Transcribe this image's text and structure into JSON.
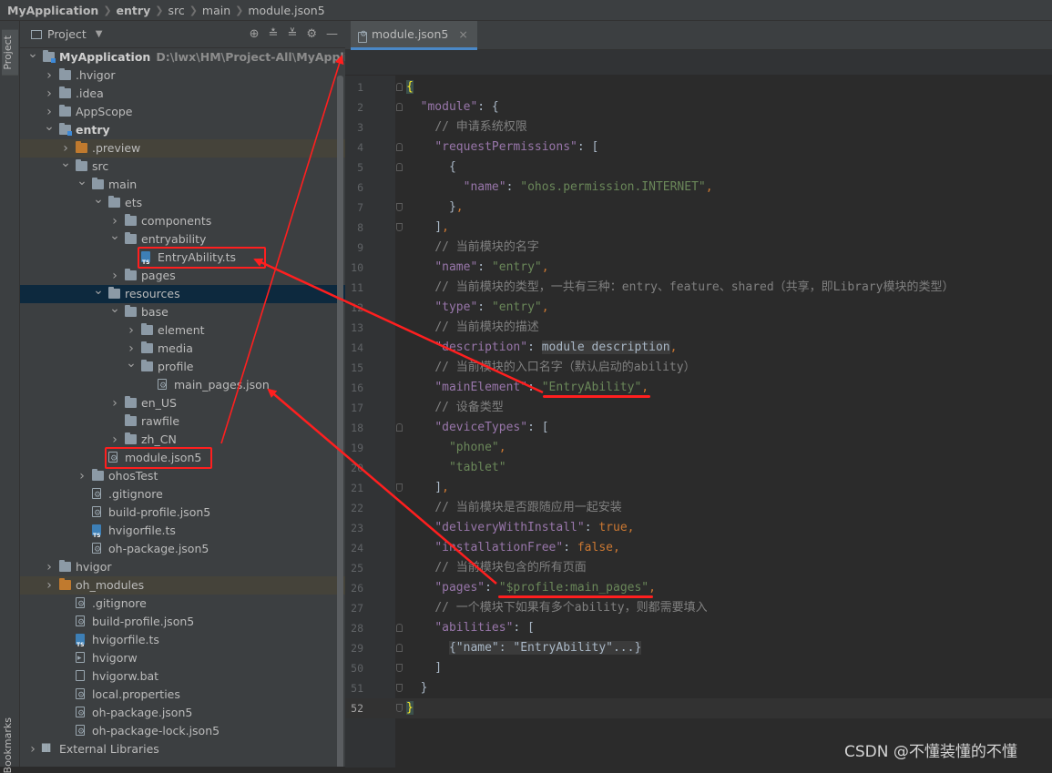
{
  "breadcrumb": [
    {
      "label": "MyApplication",
      "bold": true
    },
    {
      "label": "entry",
      "bold": true
    },
    {
      "label": "src",
      "bold": false
    },
    {
      "label": "main",
      "bold": false
    },
    {
      "label": "module.json5",
      "bold": false
    }
  ],
  "tool_windows": {
    "project": "Project",
    "bookmarks": "Bookmarks"
  },
  "panel": {
    "title": "Project",
    "tools": [
      "⊕",
      "≛",
      "≚",
      "⚙",
      "—"
    ]
  },
  "tree": [
    {
      "label": "MyApplication",
      "hint": "D:\\lwx\\HM\\Project-All\\MyApplicatic",
      "depth": 0,
      "arrow": "open",
      "icon": "folder-module",
      "bold": true
    },
    {
      "label": ".hvigor",
      "depth": 1,
      "arrow": "closed",
      "icon": "folder"
    },
    {
      "label": ".idea",
      "depth": 1,
      "arrow": "closed",
      "icon": "folder"
    },
    {
      "label": "AppScope",
      "depth": 1,
      "arrow": "closed",
      "icon": "folder"
    },
    {
      "label": "entry",
      "depth": 1,
      "arrow": "open",
      "icon": "folder-module",
      "bold": true
    },
    {
      "label": ".preview",
      "depth": 2,
      "arrow": "closed",
      "icon": "folder-orange",
      "state": "preview"
    },
    {
      "label": "src",
      "depth": 2,
      "arrow": "open",
      "icon": "folder"
    },
    {
      "label": "main",
      "depth": 3,
      "arrow": "open",
      "icon": "folder"
    },
    {
      "label": "ets",
      "depth": 4,
      "arrow": "open",
      "icon": "folder"
    },
    {
      "label": "components",
      "depth": 5,
      "arrow": "closed",
      "icon": "folder"
    },
    {
      "label": "entryability",
      "depth": 5,
      "arrow": "open",
      "icon": "folder"
    },
    {
      "label": "EntryAbility.ts",
      "depth": 6,
      "arrow": "none",
      "icon": "file-ts",
      "boxed": true
    },
    {
      "label": "pages",
      "depth": 5,
      "arrow": "closed",
      "icon": "folder"
    },
    {
      "label": "resources",
      "depth": 4,
      "arrow": "open",
      "icon": "folder",
      "state": "selected"
    },
    {
      "label": "base",
      "depth": 5,
      "arrow": "open",
      "icon": "folder"
    },
    {
      "label": "element",
      "depth": 6,
      "arrow": "closed",
      "icon": "folder"
    },
    {
      "label": "media",
      "depth": 6,
      "arrow": "closed",
      "icon": "folder"
    },
    {
      "label": "profile",
      "depth": 6,
      "arrow": "open",
      "icon": "folder"
    },
    {
      "label": "main_pages.json",
      "depth": 7,
      "arrow": "none",
      "icon": "file-gear"
    },
    {
      "label": "en_US",
      "depth": 5,
      "arrow": "closed",
      "icon": "folder"
    },
    {
      "label": "rawfile",
      "depth": 5,
      "arrow": "none",
      "icon": "folder"
    },
    {
      "label": "zh_CN",
      "depth": 5,
      "arrow": "closed",
      "icon": "folder"
    },
    {
      "label": "module.json5",
      "depth": 4,
      "arrow": "none",
      "icon": "file-gear",
      "boxed": true
    },
    {
      "label": "ohosTest",
      "depth": 3,
      "arrow": "closed",
      "icon": "folder"
    },
    {
      "label": ".gitignore",
      "depth": 3,
      "arrow": "none",
      "icon": "file-gear"
    },
    {
      "label": "build-profile.json5",
      "depth": 3,
      "arrow": "none",
      "icon": "file-gear"
    },
    {
      "label": "hvigorfile.ts",
      "depth": 3,
      "arrow": "none",
      "icon": "file-ts"
    },
    {
      "label": "oh-package.json5",
      "depth": 3,
      "arrow": "none",
      "icon": "file-gear"
    },
    {
      "label": "hvigor",
      "depth": 1,
      "arrow": "closed",
      "icon": "folder"
    },
    {
      "label": "oh_modules",
      "depth": 1,
      "arrow": "closed",
      "icon": "folder-orange",
      "state": "modules"
    },
    {
      "label": ".gitignore",
      "depth": 2,
      "arrow": "none",
      "icon": "file-gear"
    },
    {
      "label": "build-profile.json5",
      "depth": 2,
      "arrow": "none",
      "icon": "file-gear"
    },
    {
      "label": "hvigorfile.ts",
      "depth": 2,
      "arrow": "none",
      "icon": "file-ts"
    },
    {
      "label": "hvigorw",
      "depth": 2,
      "arrow": "none",
      "icon": "file-exe"
    },
    {
      "label": "hvigorw.bat",
      "depth": 2,
      "arrow": "none",
      "icon": "file"
    },
    {
      "label": "local.properties",
      "depth": 2,
      "arrow": "none",
      "icon": "file-gear"
    },
    {
      "label": "oh-package.json5",
      "depth": 2,
      "arrow": "none",
      "icon": "file-gear"
    },
    {
      "label": "oh-package-lock.json5",
      "depth": 2,
      "arrow": "none",
      "icon": "file-gear"
    },
    {
      "label": "External Libraries",
      "depth": 0,
      "arrow": "closed",
      "icon": "file-lib"
    }
  ],
  "editor": {
    "tab_label": "module.json5",
    "tab_close": "×",
    "lines": [
      {
        "n": "1",
        "fold": "up",
        "parts": [
          [
            "brace-hl",
            "{"
          ]
        ]
      },
      {
        "n": "2",
        "fold": "up",
        "parts": [
          [
            "p",
            "  "
          ],
          [
            "k",
            "\"module\""
          ],
          [
            "p",
            ": {"
          ]
        ]
      },
      {
        "n": "3",
        "parts": [
          [
            "p",
            "    "
          ],
          [
            "c",
            "// 申请系统权限"
          ]
        ]
      },
      {
        "n": "4",
        "fold": "up",
        "parts": [
          [
            "p",
            "    "
          ],
          [
            "k",
            "\"requestPermissions\""
          ],
          [
            "p",
            ": ["
          ]
        ]
      },
      {
        "n": "5",
        "fold": "up",
        "parts": [
          [
            "p",
            "      {"
          ]
        ]
      },
      {
        "n": "6",
        "parts": [
          [
            "p",
            "        "
          ],
          [
            "k",
            "\"name\""
          ],
          [
            "p",
            ": "
          ],
          [
            "s",
            "\"ohos.permission.INTERNET\""
          ],
          [
            "b",
            ","
          ]
        ]
      },
      {
        "n": "7",
        "fold": "down",
        "parts": [
          [
            "p",
            "      }"
          ],
          [
            "b",
            ","
          ]
        ]
      },
      {
        "n": "8",
        "fold": "down",
        "parts": [
          [
            "p",
            "    ]"
          ],
          [
            "b",
            ","
          ]
        ]
      },
      {
        "n": "9",
        "parts": [
          [
            "p",
            "    "
          ],
          [
            "c",
            "// 当前模块的名字"
          ]
        ]
      },
      {
        "n": "10",
        "parts": [
          [
            "p",
            "    "
          ],
          [
            "k",
            "\"name\""
          ],
          [
            "p",
            ": "
          ],
          [
            "s",
            "\"entry\""
          ],
          [
            "b",
            ","
          ]
        ]
      },
      {
        "n": "11",
        "parts": [
          [
            "p",
            "    "
          ],
          [
            "c",
            "// 当前模块的类型，一共有三种：entry、feature、shared（共享，即Library模块的类型）"
          ]
        ]
      },
      {
        "n": "12",
        "parts": [
          [
            "p",
            "    "
          ],
          [
            "k",
            "\"type\""
          ],
          [
            "p",
            ": "
          ],
          [
            "s",
            "\"entry\""
          ],
          [
            "b",
            ","
          ]
        ]
      },
      {
        "n": "13",
        "parts": [
          [
            "p",
            "    "
          ],
          [
            "c",
            "// 当前模块的描述"
          ]
        ]
      },
      {
        "n": "14",
        "parts": [
          [
            "p",
            "    "
          ],
          [
            "k",
            "\"description\""
          ],
          [
            "p",
            ": "
          ],
          [
            "g",
            "module description"
          ],
          [
            "b",
            ","
          ]
        ]
      },
      {
        "n": "15",
        "parts": [
          [
            "p",
            "    "
          ],
          [
            "c",
            "// 当前模块的入口名字（默认启动的ability）"
          ]
        ]
      },
      {
        "n": "16",
        "parts": [
          [
            "p",
            "    "
          ],
          [
            "k",
            "\"mainElement\""
          ],
          [
            "p",
            ": "
          ],
          [
            "s",
            "\"EntryAbility\""
          ],
          [
            "b",
            ","
          ]
        ]
      },
      {
        "n": "17",
        "parts": [
          [
            "p",
            "    "
          ],
          [
            "c",
            "// 设备类型"
          ]
        ]
      },
      {
        "n": "18",
        "fold": "up",
        "parts": [
          [
            "p",
            "    "
          ],
          [
            "k",
            "\"deviceTypes\""
          ],
          [
            "p",
            ": ["
          ]
        ]
      },
      {
        "n": "19",
        "parts": [
          [
            "p",
            "      "
          ],
          [
            "s",
            "\"phone\""
          ],
          [
            "b",
            ","
          ]
        ]
      },
      {
        "n": "20",
        "parts": [
          [
            "p",
            "      "
          ],
          [
            "s",
            "\"tablet\""
          ]
        ]
      },
      {
        "n": "21",
        "fold": "down",
        "parts": [
          [
            "p",
            "    ]"
          ],
          [
            "b",
            ","
          ]
        ]
      },
      {
        "n": "22",
        "parts": [
          [
            "p",
            "    "
          ],
          [
            "c",
            "// 当前模块是否跟随应用一起安装"
          ]
        ]
      },
      {
        "n": "23",
        "parts": [
          [
            "p",
            "    "
          ],
          [
            "k",
            "\"deliveryWithInstall\""
          ],
          [
            "p",
            ": "
          ],
          [
            "b",
            "true,"
          ]
        ]
      },
      {
        "n": "24",
        "parts": [
          [
            "p",
            "    "
          ],
          [
            "k",
            "\"installationFree\""
          ],
          [
            "p",
            ": "
          ],
          [
            "b",
            "false,"
          ]
        ]
      },
      {
        "n": "25",
        "parts": [
          [
            "p",
            "    "
          ],
          [
            "c",
            "// 当前模块包含的所有页面"
          ]
        ]
      },
      {
        "n": "26",
        "parts": [
          [
            "p",
            "    "
          ],
          [
            "k",
            "\"pages\""
          ],
          [
            "p",
            ": "
          ],
          [
            "s",
            "\"$profile:main_pages\""
          ],
          [
            "b",
            ","
          ]
        ]
      },
      {
        "n": "27",
        "parts": [
          [
            "p",
            "    "
          ],
          [
            "c",
            "// 一个模块下如果有多个ability，则都需要填入"
          ]
        ]
      },
      {
        "n": "28",
        "fold": "up",
        "parts": [
          [
            "p",
            "    "
          ],
          [
            "k",
            "\"abilities\""
          ],
          [
            "p",
            ": ["
          ]
        ]
      },
      {
        "n": "29",
        "fold": "up",
        "parts": [
          [
            "p",
            "      "
          ],
          [
            "g",
            "{\"name\": \"EntryAbility\"...}"
          ]
        ]
      },
      {
        "n": "50",
        "fold": "down",
        "parts": [
          [
            "p",
            "    ]"
          ]
        ]
      },
      {
        "n": "51",
        "fold": "down",
        "parts": [
          [
            "p",
            "  }"
          ]
        ]
      },
      {
        "n": "52",
        "fold": "down",
        "current": true,
        "parts": [
          [
            "brace-hl",
            "}"
          ]
        ]
      }
    ]
  },
  "watermark": "CSDN @不懂装懂的不懂",
  "colors": {
    "annotation": "#ff1f1f",
    "selection": "#0d293e",
    "accent": "#4a88c7"
  }
}
